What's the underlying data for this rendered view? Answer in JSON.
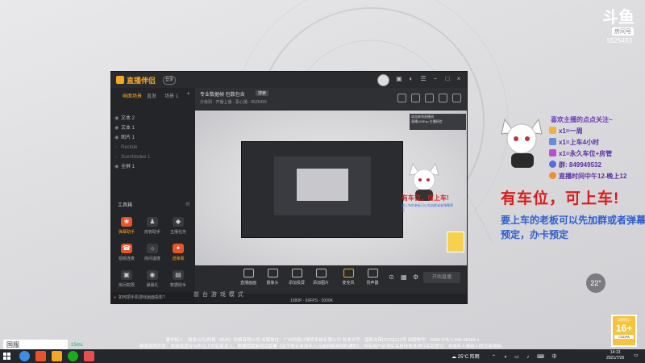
{
  "watermark": {
    "brand": "斗鱼",
    "sub": "房间号",
    "room_id": "5525493"
  },
  "app": {
    "brand": "直播伴侣",
    "version_btn": "登录",
    "scene_tabs": [
      "画面场景",
      "直发",
      "场景 1"
    ],
    "sources": [
      "文本 2",
      "文本 1",
      "图片 1",
      "Rectide",
      "ScenNodee 1",
      "全屏 1"
    ],
    "tools_title": "工具箱",
    "tools": [
      {
        "label": "弹幕助手",
        "icon": "❀",
        "hot": true
      },
      {
        "label": "房管助手",
        "icon": "♟",
        "hot": false
      },
      {
        "label": "主播任务",
        "icon": "◆",
        "hot": false
      },
      {
        "label": "视频连麦",
        "icon": "☎",
        "hot": true
      },
      {
        "label": "房间温度",
        "icon": "☼",
        "hot": false
      },
      {
        "label": "送弹幕",
        "icon": "✦",
        "hot": true
      },
      {
        "label": "房间权限",
        "icon": "▣",
        "hot": false
      },
      {
        "label": "弹幕礼",
        "icon": "◉",
        "hot": false
      },
      {
        "label": "数据助手",
        "icon": "▤",
        "hot": false
      }
    ],
    "side_footer": "如何把手机游戏画面投影?",
    "head": {
      "title": "专业数据帧 包数包含",
      "tag": "搜索",
      "sub": "分级别 · 开播上播 · 恶心播 · 5525493"
    },
    "preview": {
      "badge_line1": "欢迎来到直播间",
      "badge_line2": "直播100Exp 主播经验",
      "mini_text": "有车位，可上车!",
      "mini_blue": "要上车的老板可以先加群或者弹幕预定"
    },
    "bottom": [
      "直播画面",
      "摄像头",
      "添加投屏",
      "添加图片",
      "麦克风",
      "扬声器"
    ],
    "start_label": "开始直播"
  },
  "blurred_row": "前 台 游 戏 模 式",
  "blurred_row2": "1080P · 60FPS · 5000K",
  "overlay": {
    "title": "喜欢主播的点点关注~",
    "lines": [
      {
        "text": "x1=一周",
        "color": "#f0b43a"
      },
      {
        "text": "x1=上车4小时",
        "color": "#6a8bd8"
      },
      {
        "text": "x1=永久车位+房管",
        "color": "#b84fd0"
      },
      {
        "text": "群: 849949532",
        "color": "#5a6ae0"
      },
      {
        "text": "直播时间中午12-晚上12",
        "color": "#f09030"
      }
    ],
    "car_text": "有车位，可上车!",
    "blue_text": "要上车的老板可以先加群或者弹幕预定，办卡预定",
    "temp": "22°",
    "age": {
      "top": "适龄提示",
      "num": "16+",
      "bottom": "CADPA"
    }
  },
  "copyright": [
    "著作权人：网易公司/网易（杭州）网络有限公司 出版单位：广州网易计算机系统有限公司 批准文号：国新出审[2020]123号 出版物号：ISBN 978-7-498-08184-1",
    "健康游戏忠告：本游戏适合16岁以上的玩家进入。根据国家新闻出版署《关于防止未成年人沉迷网络游戏的通知》，所有用户必须实名身份信息进行实名登记，未成年人将纳入防沉迷限制。"
  ],
  "corner_label": "国服",
  "ping": "15ms",
  "taskbar": {
    "weather": "25°C 阵雨",
    "time": "14:13",
    "date": "2021/7/26"
  }
}
